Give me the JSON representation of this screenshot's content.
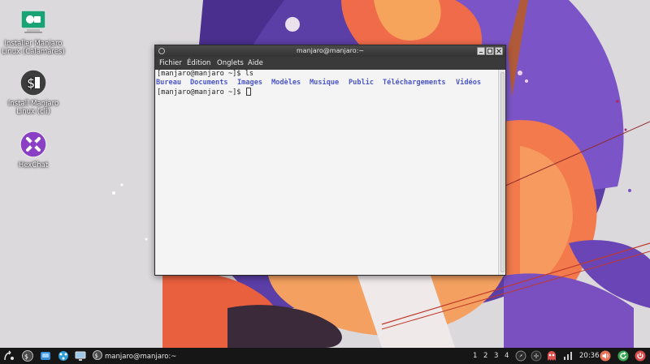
{
  "desktop": {
    "icons": [
      {
        "label": "Installer Manjaro Linux (Calamares)",
        "icon": "installer-icon"
      },
      {
        "label": "Install Manjaro Linux (cli)",
        "icon": "terminal-dollar-icon"
      },
      {
        "label": "HexChat",
        "icon": "hexchat-icon"
      }
    ]
  },
  "terminal": {
    "title": "manjaro@manjaro:~",
    "menu": [
      "Fichier",
      "Édition",
      "Onglets",
      "Aide"
    ],
    "lines": {
      "cmd1": "[manjaro@manjaro ~]$ ls",
      "prompt2": "[manjaro@manjaro ~]$ "
    },
    "dirs": [
      "Bureau",
      "Documents",
      "Images",
      "Modèles",
      "Musique",
      "Public",
      "Téléchargements",
      "Vidéos"
    ],
    "dir_color": "#4b56c8"
  },
  "taskbar": {
    "task_label": "manjaro@manjaro:~",
    "workspaces": [
      "1",
      "2",
      "3",
      "4"
    ],
    "clock": "20:36",
    "colors": {
      "power": "#d94a4a",
      "update": "#3aa655",
      "volume": "#e8735a"
    }
  }
}
